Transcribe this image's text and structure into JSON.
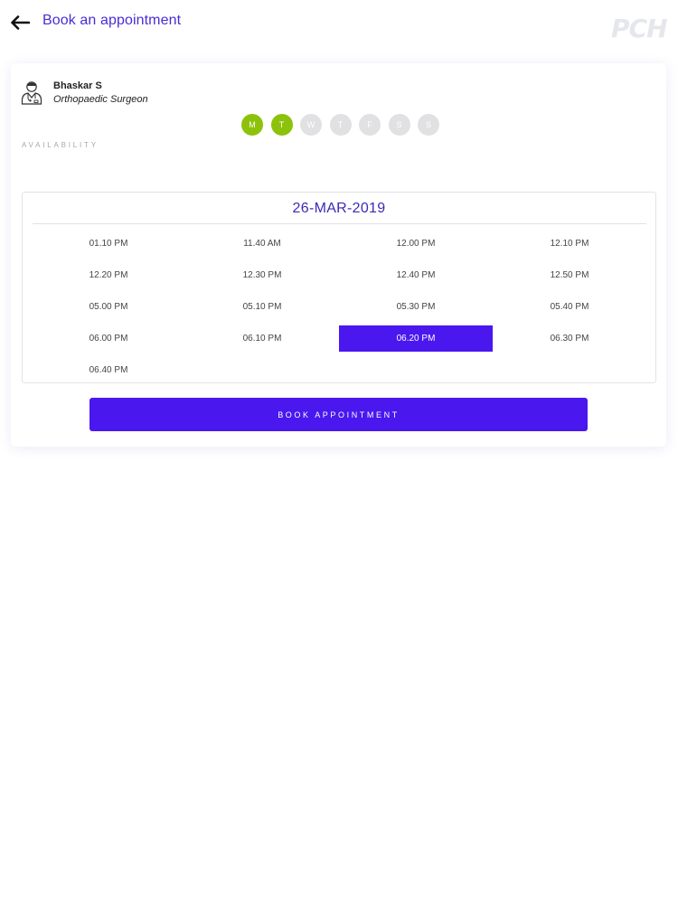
{
  "header": {
    "title": "Book an appointment",
    "logo_text": "PCH"
  },
  "doctor": {
    "name": "Bhaskar S",
    "specialty": "Orthopaedic Surgeon",
    "avatar_icon": "doctor-avatar-icon"
  },
  "availability": {
    "label": "AVAILABILITY",
    "days": [
      {
        "label": "M",
        "available": true
      },
      {
        "label": "T",
        "available": true
      },
      {
        "label": "W",
        "available": false
      },
      {
        "label": "T",
        "available": false
      },
      {
        "label": "F",
        "available": false
      },
      {
        "label": "S",
        "available": false
      },
      {
        "label": "S",
        "available": false
      }
    ]
  },
  "slots": {
    "date": "26-MAR-2019",
    "times": [
      "01.10 PM",
      "11.40 AM",
      "12.00 PM",
      "12.10 PM",
      "12.20 PM",
      "12.30 PM",
      "12.40 PM",
      "12.50 PM",
      "05.00 PM",
      "05.10 PM",
      "05.30 PM",
      "05.40 PM",
      "06.00 PM",
      "06.10 PM",
      "06.20 PM",
      "06.30 PM",
      "06.40 PM"
    ],
    "selected": "06.20 PM"
  },
  "book_button": {
    "label": "BOOK APPOINTMENT"
  },
  "colors": {
    "accent": "#4a17ef",
    "title": "#4b2bd6",
    "available_day": "#8cc20c",
    "unavailable_day": "#e1e1e3"
  }
}
